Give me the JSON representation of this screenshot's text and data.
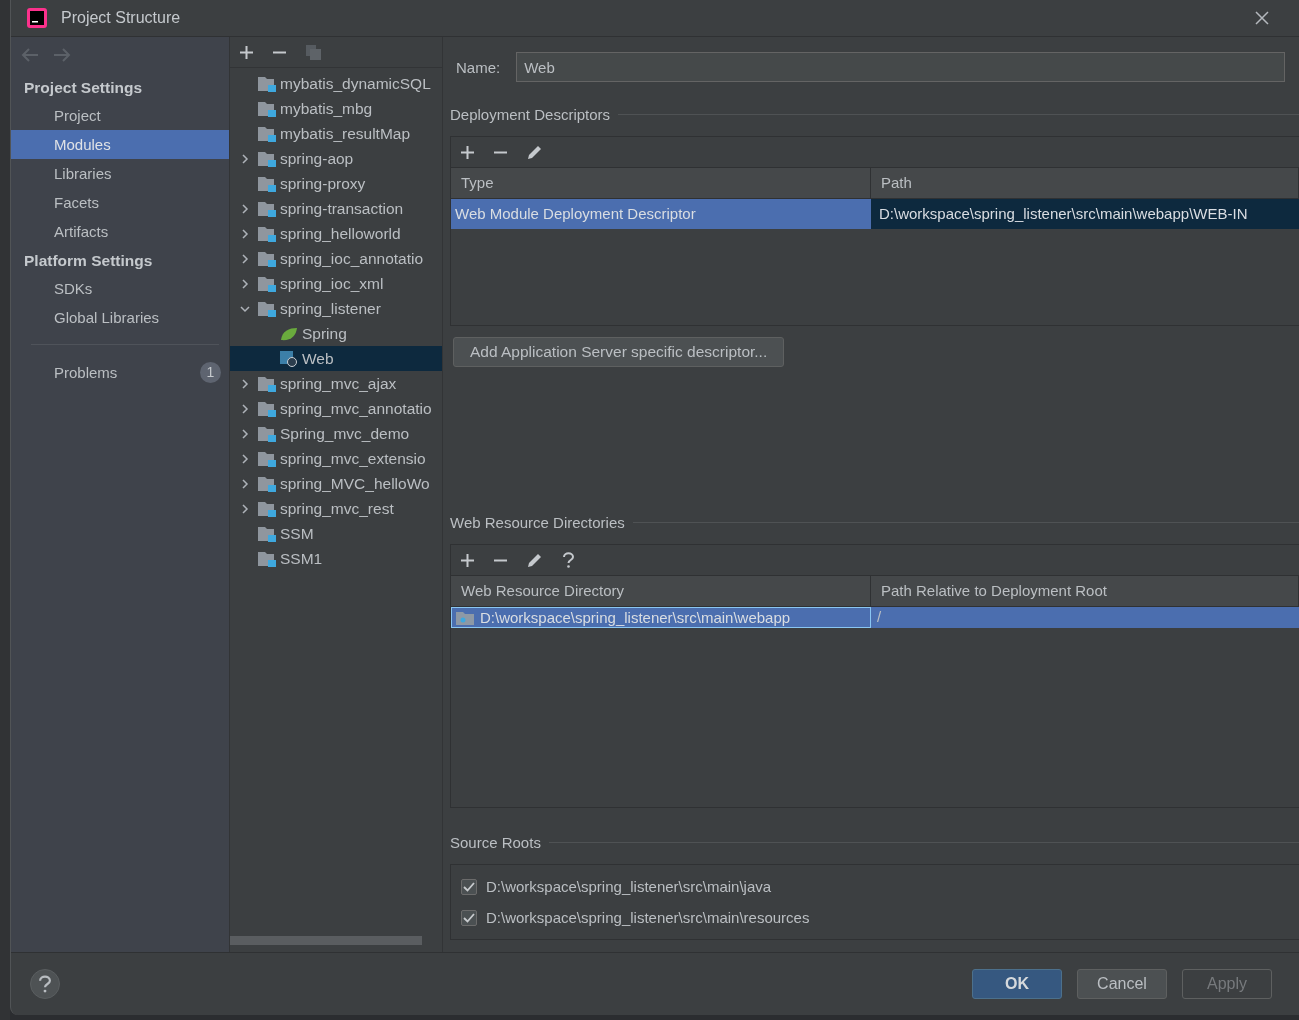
{
  "window": {
    "title": "Project Structure"
  },
  "sidebar": {
    "sections": [
      {
        "title": "Project Settings",
        "items": [
          {
            "label": "Project",
            "selected": false
          },
          {
            "label": "Modules",
            "selected": true
          },
          {
            "label": "Libraries",
            "selected": false
          },
          {
            "label": "Facets",
            "selected": false
          },
          {
            "label": "Artifacts",
            "selected": false
          }
        ]
      },
      {
        "title": "Platform Settings",
        "items": [
          {
            "label": "SDKs",
            "selected": false
          },
          {
            "label": "Global Libraries",
            "selected": false
          }
        ]
      }
    ],
    "problems": {
      "label": "Problems",
      "count": "1"
    }
  },
  "tree": [
    {
      "label": "mybatis_dynamicSQL",
      "kind": "module",
      "has_children": false,
      "expanded": false,
      "selected": false
    },
    {
      "label": "mybatis_mbg",
      "kind": "module",
      "has_children": false,
      "expanded": false,
      "selected": false
    },
    {
      "label": "mybatis_resultMap",
      "kind": "module",
      "has_children": false,
      "expanded": false,
      "selected": false
    },
    {
      "label": "spring-aop",
      "kind": "module",
      "has_children": true,
      "expanded": false,
      "selected": false
    },
    {
      "label": "spring-proxy",
      "kind": "module",
      "has_children": false,
      "expanded": false,
      "selected": false
    },
    {
      "label": "spring-transaction",
      "kind": "module",
      "has_children": true,
      "expanded": false,
      "selected": false
    },
    {
      "label": "spring_helloworld",
      "kind": "module",
      "has_children": true,
      "expanded": false,
      "selected": false
    },
    {
      "label": "spring_ioc_annotatio",
      "kind": "module",
      "has_children": true,
      "expanded": false,
      "selected": false
    },
    {
      "label": "spring_ioc_xml",
      "kind": "module",
      "has_children": true,
      "expanded": false,
      "selected": false
    },
    {
      "label": "spring_listener",
      "kind": "module",
      "has_children": true,
      "expanded": true,
      "selected": false,
      "children": [
        {
          "label": "Spring",
          "kind": "spring",
          "has_children": false,
          "expanded": false,
          "selected": false
        },
        {
          "label": "Web",
          "kind": "web",
          "has_children": false,
          "expanded": false,
          "selected": true
        }
      ]
    },
    {
      "label": "spring_mvc_ajax",
      "kind": "module",
      "has_children": true,
      "expanded": false,
      "selected": false
    },
    {
      "label": "spring_mvc_annotatio",
      "kind": "module",
      "has_children": true,
      "expanded": false,
      "selected": false
    },
    {
      "label": "Spring_mvc_demo",
      "kind": "module",
      "has_children": true,
      "expanded": false,
      "selected": false
    },
    {
      "label": "spring_mvc_extensio",
      "kind": "module",
      "has_children": true,
      "expanded": false,
      "selected": false
    },
    {
      "label": "spring_MVC_helloWo",
      "kind": "module",
      "has_children": true,
      "expanded": false,
      "selected": false
    },
    {
      "label": "spring_mvc_rest",
      "kind": "module",
      "has_children": true,
      "expanded": false,
      "selected": false
    },
    {
      "label": "SSM",
      "kind": "module",
      "has_children": false,
      "expanded": false,
      "selected": false
    },
    {
      "label": "SSM1",
      "kind": "module",
      "has_children": false,
      "expanded": false,
      "selected": false
    }
  ],
  "name_field": {
    "label": "Name:",
    "value": "Web"
  },
  "deployment_descriptors": {
    "title": "Deployment Descriptors",
    "columns": [
      "Type",
      "Path"
    ],
    "rows": [
      {
        "cells": [
          "Web Module Deployment Descriptor",
          "D:\\workspace\\spring_listener\\src\\main\\webapp\\WEB-IN"
        ],
        "selected": true
      }
    ],
    "add_button": "Add Application Server specific descriptor..."
  },
  "web_resource_directories": {
    "title": "Web Resource Directories",
    "columns": [
      "Web Resource Directory",
      "Path Relative to Deployment Root"
    ],
    "rows": [
      {
        "cells": [
          "D:\\workspace\\spring_listener\\src\\main\\webapp",
          "/"
        ],
        "selected": true
      }
    ]
  },
  "source_roots": {
    "title": "Source Roots",
    "items": [
      {
        "path": "D:\\workspace\\spring_listener\\src\\main\\java",
        "checked": true
      },
      {
        "path": "D:\\workspace\\spring_listener\\src\\main\\resources",
        "checked": true
      }
    ]
  },
  "buttons": [
    {
      "label": "OK",
      "default": true,
      "disabled": false
    },
    {
      "label": "Cancel",
      "default": false,
      "disabled": false
    },
    {
      "label": "Apply",
      "default": false,
      "disabled": true
    }
  ]
}
